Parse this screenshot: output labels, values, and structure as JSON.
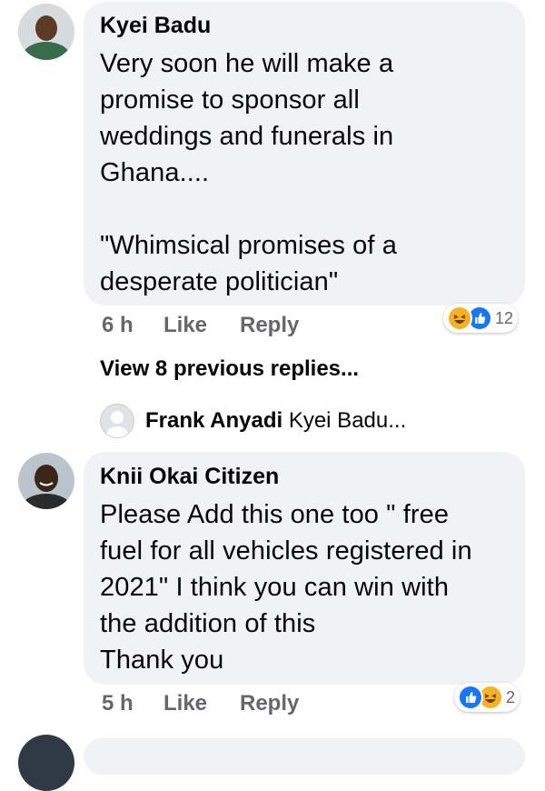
{
  "comments": [
    {
      "author": "Kyei Badu",
      "text": "Very soon he will make a\npromise to sponsor all\nweddings and funerals in\nGhana....\n\n\"Whimsical promises of a\ndesperate politician\"",
      "time": "6 h",
      "like_label": "Like",
      "reply_label": "Reply",
      "reactions": [
        "haha-icon",
        "like-icon"
      ],
      "reaction_count": "12"
    },
    {
      "author": "Knii Okai Citizen",
      "text": "Please Add this one too \" free\nfuel for all vehicles registered in\n2021\" I think you can win with\nthe addition of this\nThank you",
      "time": "5 h",
      "like_label": "Like",
      "reply_label": "Reply",
      "reactions": [
        "like-icon",
        "haha-icon"
      ],
      "reaction_count": "2"
    }
  ],
  "view_previous": "View 8 previous replies...",
  "reply_preview": {
    "author": "Frank Anyadi",
    "snippet": "Kyei Badu..."
  },
  "colors": {
    "bubble": "#f0f2f5",
    "like_blue": "#1877f2",
    "haha_yellow": "#f7b125",
    "meta_gray": "#65676b"
  }
}
